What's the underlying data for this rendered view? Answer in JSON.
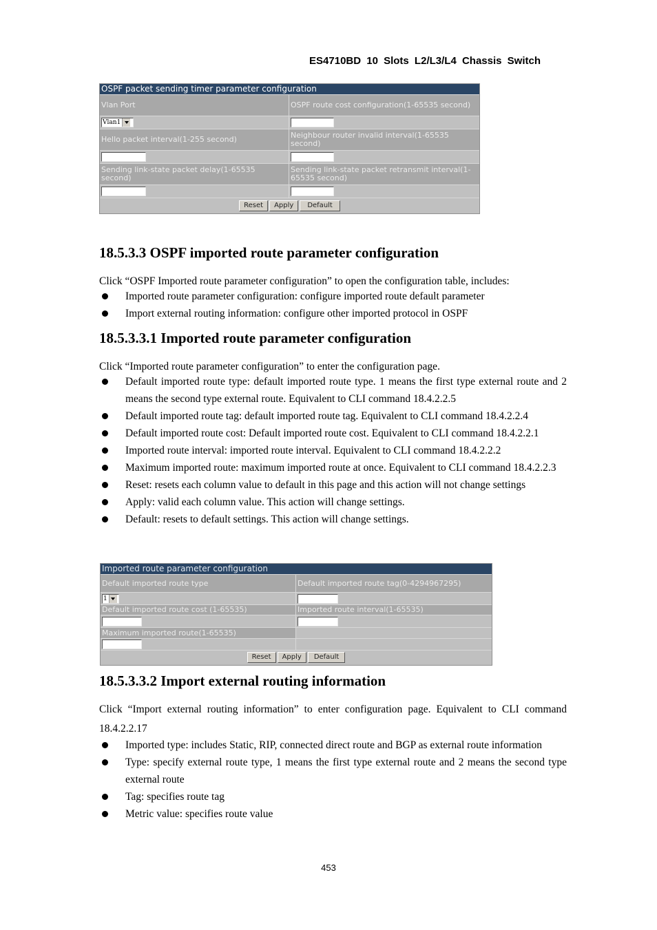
{
  "header": {
    "title": "ES4710BD  10  Slots  L2/L3/L4  Chassis  Switch"
  },
  "panel1": {
    "title": "OSPF packet sending timer parameter configuration",
    "rows": [
      {
        "left_label": "Vlan Port",
        "right_label": "OSPF route cost configuration(1-65535 second)"
      },
      {
        "left_label": "Hello packet interval(1-255 second)",
        "right_label": "Neighbour router invalid interval(1-65535 second)"
      },
      {
        "left_label": "Sending link-state packet delay(1-65535 second)",
        "right_label": "Sending link-state packet retransmit interval(1-65535 second)"
      }
    ],
    "vlan_select_value": "Vlan1",
    "buttons": {
      "reset": "Reset",
      "apply": "Apply",
      "default": "Default"
    }
  },
  "section1": {
    "heading": "18.5.3.3 OSPF imported route parameter configuration",
    "intro": "Click “OSPF Imported route parameter configuration” to open the configuration table, includes:",
    "bullets": [
      "Imported route parameter configuration: configure imported route default parameter",
      "Import external routing information: configure other imported protocol in OSPF"
    ]
  },
  "section2": {
    "heading": "18.5.3.3.1 Imported route parameter configuration",
    "intro": "Click “Imported route parameter configuration” to enter the configuration page.",
    "bullets": [
      "Default imported route type: default imported route type. 1 means the first type external route and 2 means the second type external route. Equivalent to CLI command 18.4.2.2.5",
      "Default imported route tag: default imported route tag. Equivalent to CLI command 18.4.2.2.4",
      "Default imported route cost: Default imported route cost. Equivalent to CLI command 18.4.2.2.1",
      "Imported route interval: imported route interval. Equivalent to CLI command 18.4.2.2.2",
      "Maximum imported route: maximum imported route at once. Equivalent to CLI command 18.4.2.2.3",
      "Reset: resets each column value to default in this page and this action will not change settings",
      "Apply: valid each column value. This action will change settings.",
      "Default: resets to default settings. This action will change settings."
    ]
  },
  "panel2": {
    "title": "Imported route parameter configuration",
    "labels": {
      "route_type": "Default imported route type",
      "route_tag": "Default imported route tag(0-4294967295)",
      "route_cost": "Default imported route cost (1-65535)",
      "route_interval": "Imported route interval(1-65535)",
      "max_route": "Maximum imported route(1-65535)"
    },
    "route_type_value": "1",
    "buttons": {
      "reset": "Reset",
      "apply": "Apply",
      "default": "Default"
    }
  },
  "section3": {
    "heading": "18.5.3.3.2 Import external routing information",
    "intro": "Click “Import external routing information” to enter configuration page. Equivalent to CLI command 18.4.2.2.17",
    "bullets": [
      "Imported type: includes Static, RIP, connected direct route and BGP as external route information",
      "Type: specify external route type, 1 means the first type external route and 2 means the second type external route",
      "Tag: specifies route tag",
      "Metric value: specifies route value"
    ]
  },
  "footer": {
    "page_number": "453"
  }
}
